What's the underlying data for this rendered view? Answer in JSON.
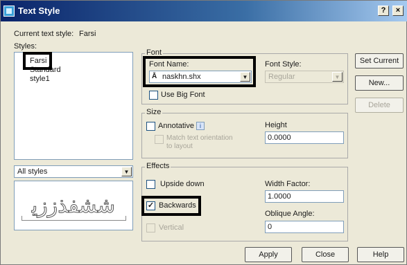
{
  "window": {
    "title": "Text Style",
    "help_button": "?",
    "close_button": "×"
  },
  "current_style": {
    "label": "Current text style:",
    "value": "Farsi"
  },
  "styles": {
    "label": "Styles:",
    "items": [
      "Farsi",
      "Standard",
      "style1"
    ],
    "filter_value": "All styles"
  },
  "preview": {
    "text": "ﺷﺸﻔﺬﺯﺯﻳ"
  },
  "font": {
    "group_label": "Font",
    "font_name_label": "Font Name:",
    "font_name_value": "naskhn.shx",
    "font_style_label": "Font Style:",
    "font_style_value": "Regular",
    "use_big_font_label": "Use Big Font"
  },
  "size": {
    "group_label": "Size",
    "annotative_label": "Annotative",
    "annotative_info": "i",
    "match_orientation_label_1": "Match text orientation",
    "match_orientation_label_2": "to layout",
    "height_label": "Height",
    "height_value": "0.0000"
  },
  "effects": {
    "group_label": "Effects",
    "upside_down_label": "Upside down",
    "backwards_label": "Backwards",
    "backwards_checked": "✓",
    "vertical_label": "Vertical",
    "width_factor_label": "Width Factor:",
    "width_factor_value": "1.0000",
    "oblique_angle_label": "Oblique Angle:",
    "oblique_angle_value": "0"
  },
  "buttons": {
    "set_current": "Set Current",
    "new": "New...",
    "delete": "Delete",
    "apply": "Apply",
    "close": "Close",
    "help": "Help"
  },
  "icons": {
    "app": "text-style-icon",
    "font": "truetype-font-icon"
  }
}
